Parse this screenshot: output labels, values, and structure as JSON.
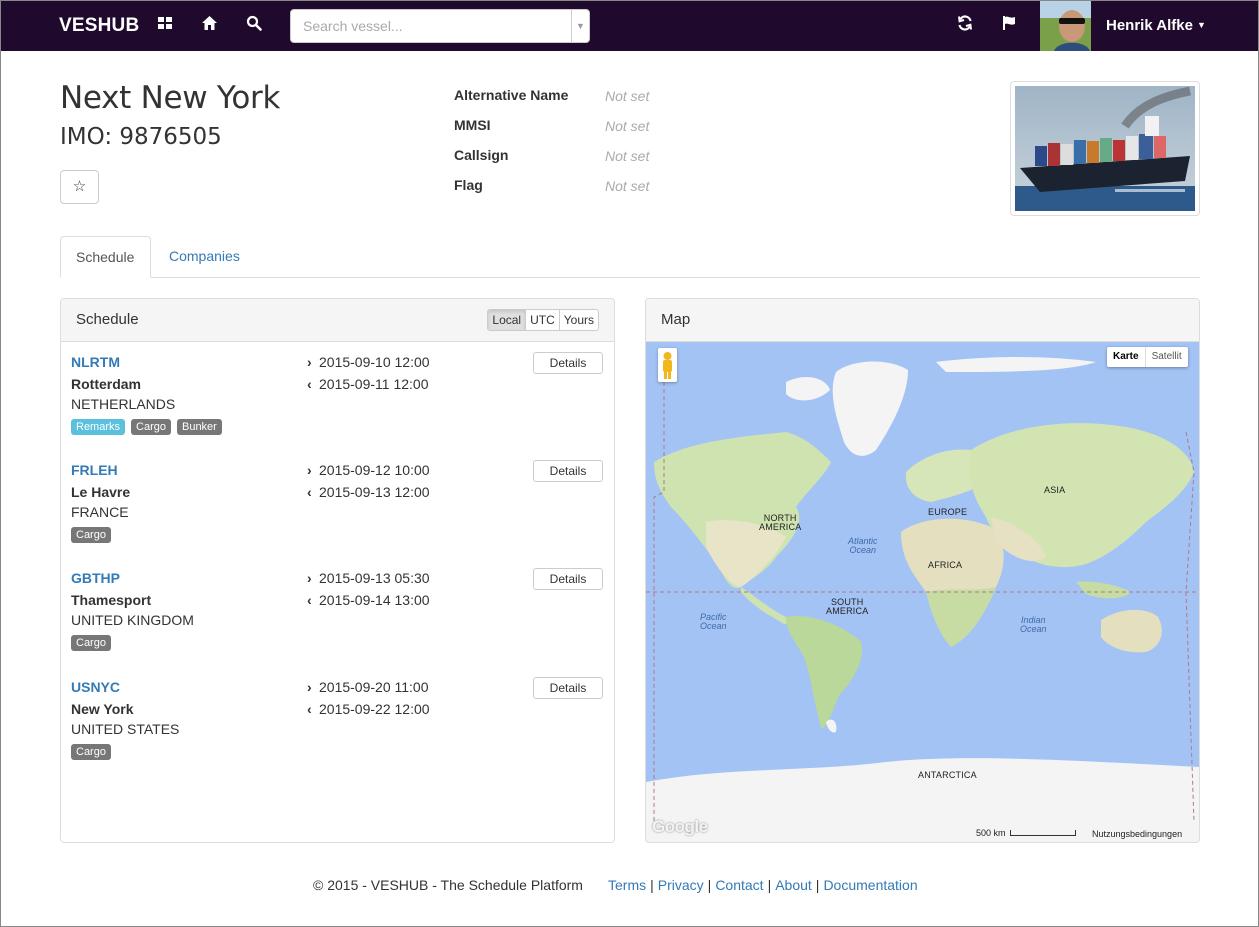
{
  "navbar": {
    "brand": "VESHUB",
    "search_placeholder": "Search vessel...",
    "user_name": "Henrik Alfke"
  },
  "vessel": {
    "name": "Next New York",
    "imo": "IMO: 9876505",
    "properties": [
      {
        "key": "Alternative Name",
        "value": "Not set"
      },
      {
        "key": "MMSI",
        "value": "Not set"
      },
      {
        "key": "Callsign",
        "value": "Not set"
      },
      {
        "key": "Flag",
        "value": "Not set"
      }
    ]
  },
  "tabs": [
    {
      "label": "Schedule",
      "active": true
    },
    {
      "label": "Companies",
      "active": false
    }
  ],
  "schedule": {
    "title": "Schedule",
    "timezones": [
      "Local",
      "UTC",
      "Yours"
    ],
    "selected_timezone": "Local",
    "details_label": "Details",
    "entries": [
      {
        "code": "NLRTM",
        "city": "Rotterdam",
        "country": "NETHERLANDS",
        "arrival": "2015-09-10 12:00",
        "departure": "2015-09-11 12:00",
        "tags": [
          "Remarks",
          "Cargo",
          "Bunker"
        ]
      },
      {
        "code": "FRLEH",
        "city": "Le Havre",
        "country": "FRANCE",
        "arrival": "2015-09-12 10:00",
        "departure": "2015-09-13 12:00",
        "tags": [
          "Cargo"
        ]
      },
      {
        "code": "GBTHP",
        "city": "Thamesport",
        "country": "UNITED KINGDOM",
        "arrival": "2015-09-13 05:30",
        "departure": "2015-09-14 13:00",
        "tags": [
          "Cargo"
        ]
      },
      {
        "code": "USNYC",
        "city": "New York",
        "country": "UNITED STATES",
        "arrival": "2015-09-20 11:00",
        "departure": "2015-09-22 12:00",
        "tags": [
          "Cargo"
        ]
      }
    ]
  },
  "map": {
    "title": "Map",
    "types": [
      "Karte",
      "Satellit"
    ],
    "selected_type": "Karte",
    "labels": {
      "north_america": "NORTH\nAMERICA",
      "south_america": "SOUTH\nAMERICA",
      "europe": "EUROPE",
      "africa": "AFRICA",
      "asia": "ASIA",
      "antarctica": "ANTARCTICA",
      "atlantic": "Atlantic\nOcean",
      "pacific": "Pacific\nOcean",
      "indian": "Indian\nOcean"
    },
    "logo": "Google",
    "scale": "500 km",
    "terms": "Nutzungsbedingungen"
  },
  "footer": {
    "copyright": "© 2015 - VESHUB - The Schedule Platform",
    "links": [
      "Terms",
      "Privacy",
      "Contact",
      "About",
      "Documentation"
    ]
  },
  "colors": {
    "navbar": "#1f0a2e",
    "link": "#337ab7",
    "tag_default": "#777777",
    "tag_info": "#5bc0de",
    "water": "#a3c3f5"
  }
}
